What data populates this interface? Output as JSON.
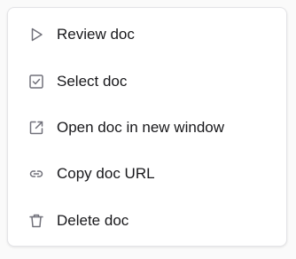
{
  "menu": {
    "items": [
      {
        "label": "Review doc",
        "icon": "play-icon"
      },
      {
        "label": "Select doc",
        "icon": "checkbox-icon"
      },
      {
        "label": "Open doc in new window",
        "icon": "external-link-icon"
      },
      {
        "label": "Copy doc URL",
        "icon": "link-icon"
      },
      {
        "label": "Delete doc",
        "icon": "trash-icon"
      }
    ]
  },
  "colors": {
    "icon": "#71717a",
    "text": "#18181b",
    "border": "#e4e4e7",
    "background": "#ffffff"
  }
}
